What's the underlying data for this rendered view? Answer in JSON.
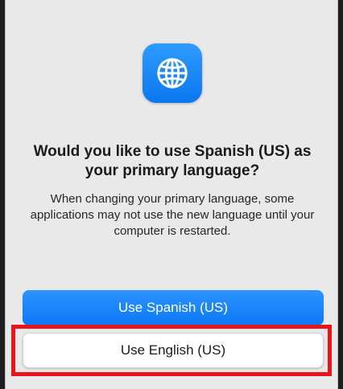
{
  "dialog": {
    "icon": "globe-icon",
    "accent_color": "#0b78f4",
    "title": "Would you like to use Spanish (US) as your primary language?",
    "message": "When changing your primary language, some applications may not use the new language until your computer is restarted.",
    "primary_button": "Use Spanish (US)",
    "secondary_button": "Use English (US)"
  },
  "annotation": {
    "highlight_color": "#e8151b"
  }
}
